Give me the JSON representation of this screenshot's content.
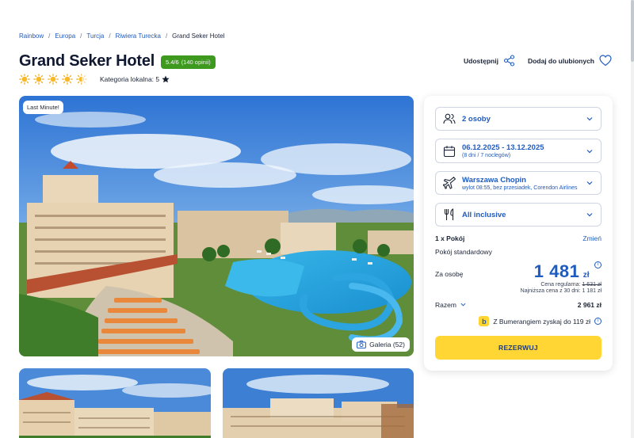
{
  "breadcrumb": {
    "items": [
      "Rainbow",
      "Europa",
      "Turcja",
      "Riwiera Turecka"
    ],
    "current": "Grand Seker Hotel"
  },
  "hotel": {
    "name": "Grand Seker Hotel",
    "rating": "5.4/6",
    "reviews": "(140 opinii)",
    "suns": 4.5,
    "category_label": "Kategoria lokalna: 5"
  },
  "actions": {
    "share": "Udostępnij",
    "favorite": "Dodaj do ulubionych"
  },
  "photo": {
    "badge": "Last Minute!",
    "gallery": "Galeria (52)"
  },
  "booking": {
    "persons": "2 osoby",
    "dates": "06.12.2025 - 13.12.2025",
    "dates_sub": "(8 dni / 7 noclegów)",
    "departure": "Warszawa Chopin",
    "departure_sub": "wylot 08:55, bez przesiadek, Corendon Airlines",
    "board": "All inclusive",
    "room_count": "1 x Pokój",
    "change": "Zmień",
    "room_type": "Pokój standardowy",
    "per_person_label": "Za osobę",
    "price": "1 481",
    "currency": "zł",
    "regular_label": "Cena regularna:",
    "regular_price": "1 631 zł",
    "lowest": "Najniższa cena z 30 dni: 1 181 zł",
    "total_label": "Razem",
    "total": "2 961 zł",
    "bumerang": "Z Bumerangiem zyskaj do 119 zł",
    "reserve": "REZERWUJ"
  },
  "colors": {
    "accent": "#1f5bbf",
    "rating_green": "#3d9a1e",
    "reserve_yellow": "#ffd633"
  }
}
